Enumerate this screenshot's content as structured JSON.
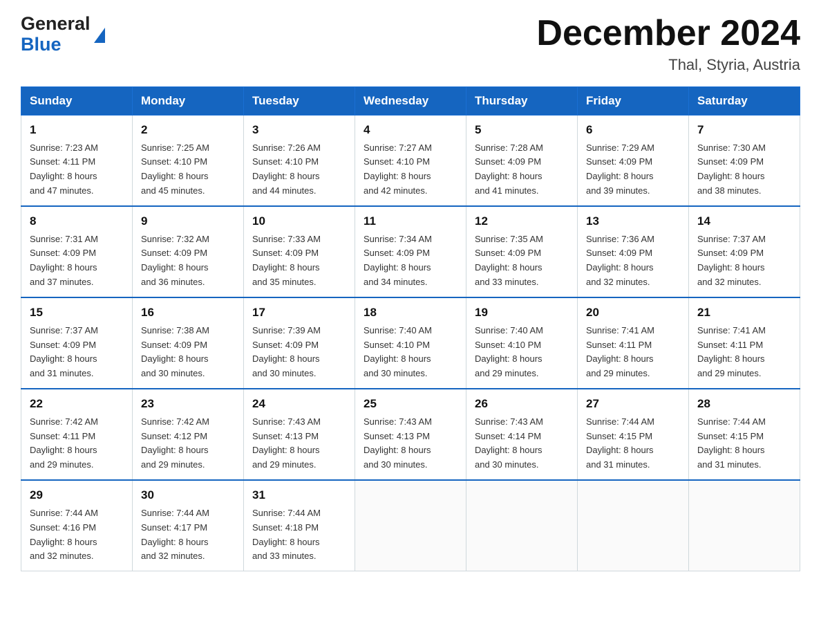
{
  "header": {
    "logo_general": "General",
    "logo_blue": "Blue",
    "title": "December 2024",
    "subtitle": "Thal, Styria, Austria"
  },
  "calendar": {
    "headers": [
      "Sunday",
      "Monday",
      "Tuesday",
      "Wednesday",
      "Thursday",
      "Friday",
      "Saturday"
    ],
    "weeks": [
      [
        {
          "day": "1",
          "info": "Sunrise: 7:23 AM\nSunset: 4:11 PM\nDaylight: 8 hours\nand 47 minutes."
        },
        {
          "day": "2",
          "info": "Sunrise: 7:25 AM\nSunset: 4:10 PM\nDaylight: 8 hours\nand 45 minutes."
        },
        {
          "day": "3",
          "info": "Sunrise: 7:26 AM\nSunset: 4:10 PM\nDaylight: 8 hours\nand 44 minutes."
        },
        {
          "day": "4",
          "info": "Sunrise: 7:27 AM\nSunset: 4:10 PM\nDaylight: 8 hours\nand 42 minutes."
        },
        {
          "day": "5",
          "info": "Sunrise: 7:28 AM\nSunset: 4:09 PM\nDaylight: 8 hours\nand 41 minutes."
        },
        {
          "day": "6",
          "info": "Sunrise: 7:29 AM\nSunset: 4:09 PM\nDaylight: 8 hours\nand 39 minutes."
        },
        {
          "day": "7",
          "info": "Sunrise: 7:30 AM\nSunset: 4:09 PM\nDaylight: 8 hours\nand 38 minutes."
        }
      ],
      [
        {
          "day": "8",
          "info": "Sunrise: 7:31 AM\nSunset: 4:09 PM\nDaylight: 8 hours\nand 37 minutes."
        },
        {
          "day": "9",
          "info": "Sunrise: 7:32 AM\nSunset: 4:09 PM\nDaylight: 8 hours\nand 36 minutes."
        },
        {
          "day": "10",
          "info": "Sunrise: 7:33 AM\nSunset: 4:09 PM\nDaylight: 8 hours\nand 35 minutes."
        },
        {
          "day": "11",
          "info": "Sunrise: 7:34 AM\nSunset: 4:09 PM\nDaylight: 8 hours\nand 34 minutes."
        },
        {
          "day": "12",
          "info": "Sunrise: 7:35 AM\nSunset: 4:09 PM\nDaylight: 8 hours\nand 33 minutes."
        },
        {
          "day": "13",
          "info": "Sunrise: 7:36 AM\nSunset: 4:09 PM\nDaylight: 8 hours\nand 32 minutes."
        },
        {
          "day": "14",
          "info": "Sunrise: 7:37 AM\nSunset: 4:09 PM\nDaylight: 8 hours\nand 32 minutes."
        }
      ],
      [
        {
          "day": "15",
          "info": "Sunrise: 7:37 AM\nSunset: 4:09 PM\nDaylight: 8 hours\nand 31 minutes."
        },
        {
          "day": "16",
          "info": "Sunrise: 7:38 AM\nSunset: 4:09 PM\nDaylight: 8 hours\nand 30 minutes."
        },
        {
          "day": "17",
          "info": "Sunrise: 7:39 AM\nSunset: 4:09 PM\nDaylight: 8 hours\nand 30 minutes."
        },
        {
          "day": "18",
          "info": "Sunrise: 7:40 AM\nSunset: 4:10 PM\nDaylight: 8 hours\nand 30 minutes."
        },
        {
          "day": "19",
          "info": "Sunrise: 7:40 AM\nSunset: 4:10 PM\nDaylight: 8 hours\nand 29 minutes."
        },
        {
          "day": "20",
          "info": "Sunrise: 7:41 AM\nSunset: 4:11 PM\nDaylight: 8 hours\nand 29 minutes."
        },
        {
          "day": "21",
          "info": "Sunrise: 7:41 AM\nSunset: 4:11 PM\nDaylight: 8 hours\nand 29 minutes."
        }
      ],
      [
        {
          "day": "22",
          "info": "Sunrise: 7:42 AM\nSunset: 4:11 PM\nDaylight: 8 hours\nand 29 minutes."
        },
        {
          "day": "23",
          "info": "Sunrise: 7:42 AM\nSunset: 4:12 PM\nDaylight: 8 hours\nand 29 minutes."
        },
        {
          "day": "24",
          "info": "Sunrise: 7:43 AM\nSunset: 4:13 PM\nDaylight: 8 hours\nand 29 minutes."
        },
        {
          "day": "25",
          "info": "Sunrise: 7:43 AM\nSunset: 4:13 PM\nDaylight: 8 hours\nand 30 minutes."
        },
        {
          "day": "26",
          "info": "Sunrise: 7:43 AM\nSunset: 4:14 PM\nDaylight: 8 hours\nand 30 minutes."
        },
        {
          "day": "27",
          "info": "Sunrise: 7:44 AM\nSunset: 4:15 PM\nDaylight: 8 hours\nand 31 minutes."
        },
        {
          "day": "28",
          "info": "Sunrise: 7:44 AM\nSunset: 4:15 PM\nDaylight: 8 hours\nand 31 minutes."
        }
      ],
      [
        {
          "day": "29",
          "info": "Sunrise: 7:44 AM\nSunset: 4:16 PM\nDaylight: 8 hours\nand 32 minutes."
        },
        {
          "day": "30",
          "info": "Sunrise: 7:44 AM\nSunset: 4:17 PM\nDaylight: 8 hours\nand 32 minutes."
        },
        {
          "day": "31",
          "info": "Sunrise: 7:44 AM\nSunset: 4:18 PM\nDaylight: 8 hours\nand 33 minutes."
        },
        {
          "day": "",
          "info": ""
        },
        {
          "day": "",
          "info": ""
        },
        {
          "day": "",
          "info": ""
        },
        {
          "day": "",
          "info": ""
        }
      ]
    ]
  }
}
